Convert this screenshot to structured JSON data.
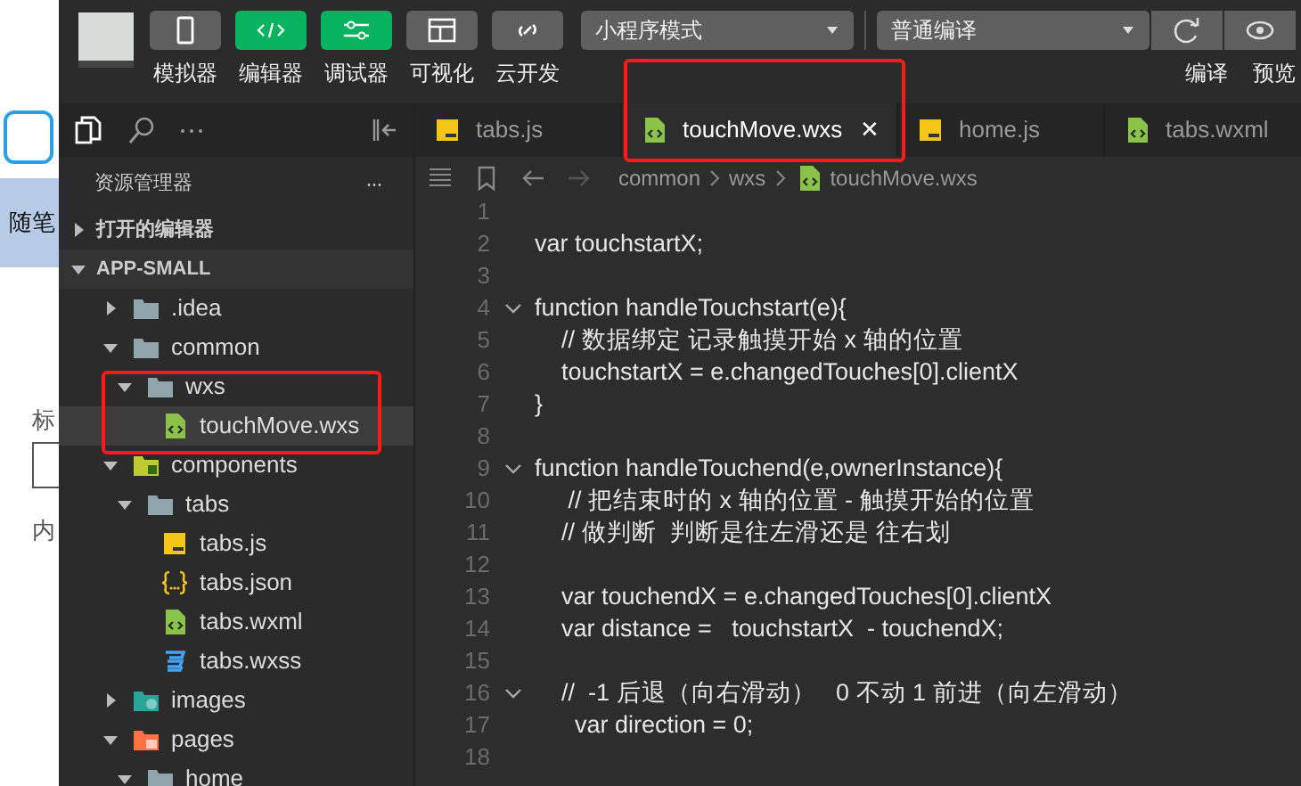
{
  "background_page": {
    "texts": [
      "随笔",
      "标",
      "内"
    ]
  },
  "toolbar": {
    "buttons": [
      {
        "label": "模拟器",
        "kind": "simulator",
        "active": false
      },
      {
        "label": "编辑器",
        "kind": "editor",
        "active": true
      },
      {
        "label": "调试器",
        "kind": "debugger",
        "active": true
      },
      {
        "label": "可视化",
        "kind": "visual",
        "active": false
      },
      {
        "label": "云开发",
        "kind": "cloud",
        "active": false
      }
    ],
    "mode_select": "小程序模式",
    "compile_select": "普通编译",
    "right_labels": [
      "编译",
      "预览"
    ]
  },
  "sidebar": {
    "title": "资源管理器",
    "more": "···",
    "sections": [
      {
        "label": "打开的编辑器",
        "expanded": false
      },
      {
        "label": "APP-SMALL",
        "expanded": true,
        "children": [
          {
            "label": ".idea",
            "kind": "folder",
            "expanded": false,
            "selected": false
          },
          {
            "label": "common",
            "kind": "folder",
            "expanded": true,
            "selected": false,
            "children": [
              {
                "label": "wxs",
                "kind": "folder",
                "expanded": true,
                "selected": false,
                "children": [
                  {
                    "label": "touchMove.wxs",
                    "kind": "wxml",
                    "selected": true
                  }
                ]
              }
            ]
          },
          {
            "label": "components",
            "kind": "components",
            "expanded": true,
            "selected": false,
            "children": [
              {
                "label": "tabs",
                "kind": "folder",
                "expanded": true,
                "selected": false,
                "children": [
                  {
                    "label": "tabs.js",
                    "kind": "js",
                    "selected": false
                  },
                  {
                    "label": "tabs.json",
                    "kind": "json",
                    "selected": false
                  },
                  {
                    "label": "tabs.wxml",
                    "kind": "wxml",
                    "selected": false
                  },
                  {
                    "label": "tabs.wxss",
                    "kind": "wxss",
                    "selected": false
                  }
                ]
              }
            ]
          },
          {
            "label": "images",
            "kind": "images",
            "expanded": false,
            "selected": false
          },
          {
            "label": "pages",
            "kind": "pages",
            "expanded": true,
            "selected": false,
            "children": [
              {
                "label": "home",
                "kind": "folder",
                "expanded": true,
                "selected": false
              }
            ]
          }
        ]
      }
    ]
  },
  "tabs": [
    {
      "label": "tabs.js",
      "kind": "js",
      "selected": false
    },
    {
      "label": "touchMove.wxs",
      "kind": "wxml",
      "selected": true,
      "close": "✕"
    },
    {
      "label": "home.js",
      "kind": "js",
      "selected": false
    },
    {
      "label": "tabs.wxml",
      "kind": "wxml",
      "selected": false
    }
  ],
  "breadcrumb": [
    "common",
    "wxs",
    "touchMove.wxs"
  ],
  "code": [
    {
      "number": "1",
      "foldable": false
    },
    {
      "number": "2",
      "text": "var touchstartX;",
      "foldable": false
    },
    {
      "number": "3",
      "foldable": false
    },
    {
      "number": "4",
      "text": "function handleTouchstart(e){",
      "foldable": true
    },
    {
      "number": "5",
      "text": "    // 数据绑定 记录触摸开始 x 轴的位置",
      "foldable": false
    },
    {
      "number": "6",
      "text": "    touchstartX = e.changedTouches[0].clientX",
      "foldable": false
    },
    {
      "number": "7",
      "text": "}",
      "foldable": false
    },
    {
      "number": "8",
      "foldable": false
    },
    {
      "number": "9",
      "text": "function handleTouchend(e,ownerInstance){",
      "foldable": true
    },
    {
      "number": "10",
      "text": "     // 把结束时的 x 轴的位置 - 触摸开始的位置",
      "foldable": false
    },
    {
      "number": "11",
      "text": "    // 做判断  判断是往左滑还是 往右划",
      "foldable": false
    },
    {
      "number": "12",
      "foldable": false
    },
    {
      "number": "13",
      "text": "    var touchendX = e.changedTouches[0].clientX",
      "foldable": false
    },
    {
      "number": "14",
      "text": "    var distance =   touchstartX  - touchendX;",
      "foldable": false
    },
    {
      "number": "15",
      "foldable": false
    },
    {
      "number": "16",
      "text": "    //  -1 后退（向右滑动）   0 不动 1 前进（向左滑动）",
      "foldable": true
    },
    {
      "number": "17",
      "text": "      var direction = 0;",
      "foldable": false
    },
    {
      "number": "18",
      "foldable": false
    }
  ],
  "annotation_frames": {
    "selected_tab": true,
    "wxs_folder": true
  }
}
